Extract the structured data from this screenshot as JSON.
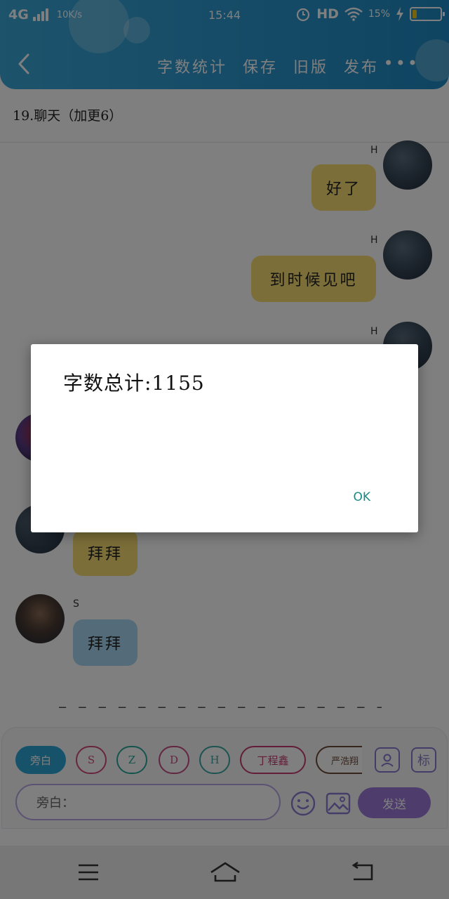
{
  "statusbar": {
    "network": "4G",
    "speed": "10K/s",
    "time": "15:44",
    "hd": "HD",
    "battery_pct": "15%"
  },
  "nav": {
    "back_icon": "chevron-left-icon",
    "items": [
      "字数统计",
      "保存",
      "旧版",
      "发布"
    ],
    "more": "•••"
  },
  "doc_title": "19.聊天（加更6）",
  "messages": [
    {
      "sender": "H",
      "text": "好了",
      "side": "right",
      "color": "yellow"
    },
    {
      "sender": "H",
      "text": "到时候见吧",
      "side": "right",
      "color": "yellow"
    },
    {
      "sender": "H",
      "text": "",
      "side": "right",
      "color": "yellow"
    },
    {
      "sender": "",
      "text": "",
      "side": "left",
      "color": "yellow"
    },
    {
      "sender": "",
      "text": "拜拜",
      "side": "left",
      "color": "yellow"
    },
    {
      "sender": "S",
      "text": "拜拜",
      "side": "left",
      "color": "blue"
    }
  ],
  "dashes": "_ _ _ _ _ _ _ _ _ _ _ _ _ _ _ _ _",
  "role_chips": [
    "旁白",
    "S",
    "Z",
    "D",
    "H",
    "丁程鑫",
    "严浩翔"
  ],
  "input": {
    "value": "旁白："
  },
  "send_label": "发送",
  "tag_label": "标",
  "dialog": {
    "message": "字数总计:1155",
    "ok_label": "OK"
  },
  "colors": {
    "header": "#2f9bd0",
    "bubble_yellow": "#f7dc72",
    "bubble_blue": "#a9d7f2",
    "send": "#9b78d9",
    "ok": "#1a8a86"
  }
}
